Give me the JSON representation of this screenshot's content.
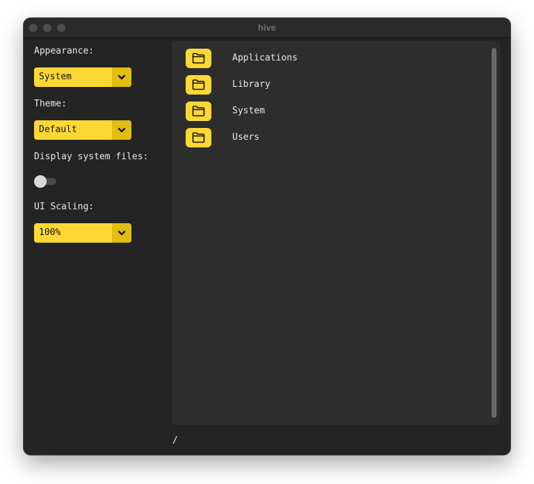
{
  "window": {
    "title": "hive"
  },
  "sidebar": {
    "appearance": {
      "label": "Appearance:",
      "value": "System"
    },
    "theme": {
      "label": "Theme:",
      "value": "Default"
    },
    "system_files": {
      "label": "Display system files:",
      "enabled": false
    },
    "scaling": {
      "label": "UI Scaling:",
      "value": "100%"
    }
  },
  "files": {
    "items": [
      {
        "name": "Applications",
        "icon": "folder-icon"
      },
      {
        "name": "Library",
        "icon": "folder-icon"
      },
      {
        "name": "System",
        "icon": "folder-icon"
      },
      {
        "name": "Users",
        "icon": "folder-icon"
      }
    ]
  },
  "status": {
    "path": "/"
  },
  "colors": {
    "accent": "#fdd835",
    "accent_dark": "#e2bd12",
    "background": "#242424",
    "panel": "#2d2d2d"
  }
}
